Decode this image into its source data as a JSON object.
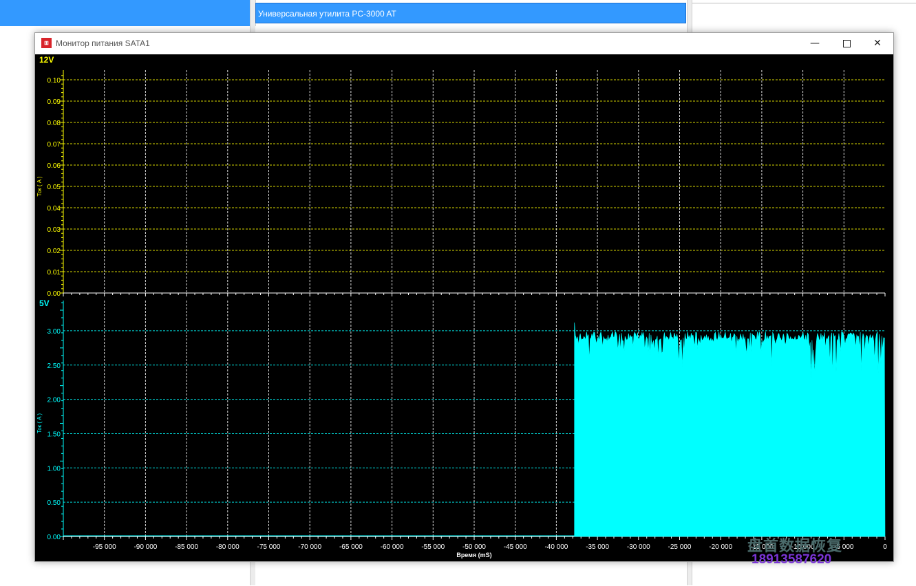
{
  "background": {
    "center_title": "Универсальная утилита PC-3000 AT"
  },
  "window": {
    "title": "Монитор питания SATA1",
    "icon": "pc3000-app-icon",
    "controls": [
      "minimize-icon",
      "maximize-icon",
      "close-icon"
    ]
  },
  "colors": {
    "top_channel": "#ffff00",
    "bottom_channel": "#00ffff",
    "grid_lines": "#ffffff",
    "background": "#000000",
    "selection": "#3399ff"
  },
  "watermark": {
    "line1": "盘首数据恢复",
    "line2": "18913587620"
  },
  "chart_data": [
    {
      "type": "area",
      "channel_label": "12V",
      "ylabel": "Ток ( A )",
      "ylim": [
        0,
        0.1
      ],
      "yticks": [
        "0.00",
        "0.01",
        "0.02",
        "0.03",
        "0.04",
        "0.05",
        "0.06",
        "0.07",
        "0.08",
        "0.09",
        "0.10"
      ],
      "grid": true,
      "series": []
    },
    {
      "type": "area",
      "channel_label": "5V",
      "ylabel": "Ток ( A )",
      "xlabel": "Время (mS)",
      "ylim": [
        0,
        3.3
      ],
      "xlim": [
        -100000,
        0
      ],
      "yticks": [
        "0.00",
        "0.50",
        "1.00",
        "1.50",
        "2.00",
        "2.50",
        "3.00"
      ],
      "xticks": [
        {
          "value": -95000,
          "label": "-95 000"
        },
        {
          "value": -90000,
          "label": "-90 000"
        },
        {
          "value": -85000,
          "label": "-85 000"
        },
        {
          "value": -80000,
          "label": "-80 000"
        },
        {
          "value": -75000,
          "label": "-75 000"
        },
        {
          "value": -70000,
          "label": "-70 000"
        },
        {
          "value": -65000,
          "label": "-65 000"
        },
        {
          "value": -60000,
          "label": "-60 000"
        },
        {
          "value": -55000,
          "label": "-55 000"
        },
        {
          "value": -50000,
          "label": "-50 000"
        },
        {
          "value": -45000,
          "label": "-45 000"
        },
        {
          "value": -40000,
          "label": "-40 000"
        },
        {
          "value": -35000,
          "label": "-35 000"
        },
        {
          "value": -30000,
          "label": "-30 000"
        },
        {
          "value": -25000,
          "label": "-25 000"
        },
        {
          "value": -20000,
          "label": "-20 000"
        },
        {
          "value": -15000,
          "label": "-15 000"
        },
        {
          "value": -10000,
          "label": "-10 000"
        },
        {
          "value": -5000,
          "label": "-5 000"
        },
        {
          "value": 0,
          "label": "0"
        }
      ],
      "grid": true,
      "series": [
        {
          "start": -37800,
          "end": 0,
          "peak": 3.12,
          "max": 3.0,
          "typical": 2.92,
          "min": 2.3,
          "baseline_before": 0.0
        }
      ]
    }
  ]
}
